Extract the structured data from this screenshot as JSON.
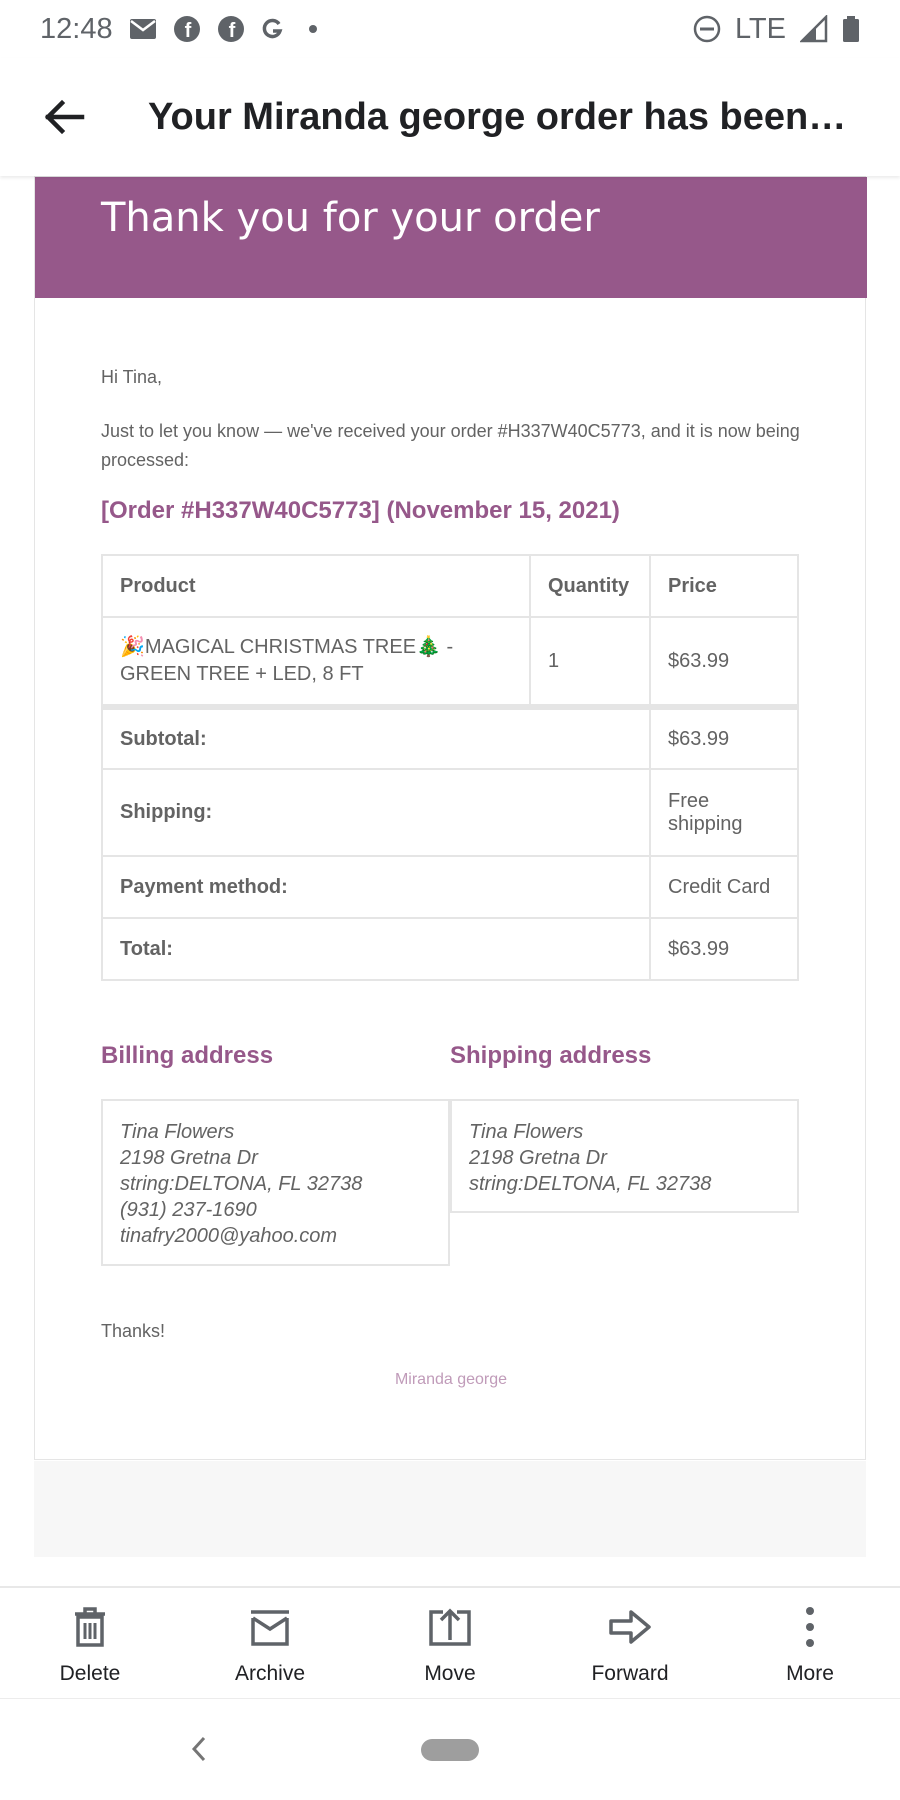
{
  "status_bar": {
    "time": "12:48",
    "network": "LTE",
    "icons": [
      "mail-icon",
      "facebook-icon",
      "facebook-icon",
      "google-icon",
      "dot-icon",
      "dnd-icon",
      "signal-icon",
      "battery-icon"
    ]
  },
  "app_bar": {
    "back_icon": "arrow-left-icon",
    "subject": "Your Miranda george order has been re..."
  },
  "email": {
    "header_title": "Thank you for your order",
    "greeting": "Hi Tina,",
    "intro": "Just to let you know — we've received your order #H337W40C5773, and it is now being processed:",
    "order_heading": "[Order #H337W40C5773] (November 15, 2021)",
    "table": {
      "headers": [
        "Product",
        "Quantity",
        "Price"
      ],
      "items": [
        {
          "emoji_left": "🎉",
          "name": "MAGICAL CHRISTMAS TREE",
          "emoji_right": "🎄",
          "rest": " - GREEN TREE + LED, 8 FT",
          "quantity": "1",
          "price": "$63.99"
        }
      ],
      "totals": [
        {
          "label": "Subtotal:",
          "value": "$63.99"
        },
        {
          "label": "Shipping:",
          "value": "Free shipping"
        },
        {
          "label": "Payment method:",
          "value": "Credit Card"
        },
        {
          "label": "Total:",
          "value": "$63.99"
        }
      ]
    },
    "billing": {
      "title": "Billing address",
      "lines": [
        "Tina Flowers",
        "2198 Gretna Dr",
        "string:DELTONA, FL 32738",
        "(931) 237-1690",
        "tinafry2000@yahoo.com"
      ]
    },
    "shipping": {
      "title": "Shipping address",
      "lines": [
        "Tina Flowers",
        "2198 Gretna Dr",
        "string:DELTONA, FL 32738"
      ]
    },
    "thanks": "Thanks!",
    "footer": "Miranda george"
  },
  "actions": [
    {
      "label": "Delete",
      "icon": "trash-icon"
    },
    {
      "label": "Archive",
      "icon": "archive-icon"
    },
    {
      "label": "Move",
      "icon": "move-icon"
    },
    {
      "label": "Forward",
      "icon": "forward-icon"
    },
    {
      "label": "More",
      "icon": "more-vertical-icon"
    }
  ],
  "colors": {
    "brand": "#96588a",
    "text": "#636363",
    "footer": "#c09bb9"
  }
}
